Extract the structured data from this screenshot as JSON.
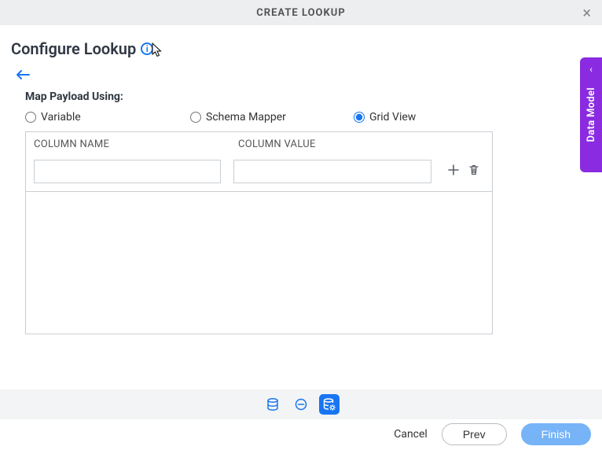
{
  "modal": {
    "title": "CREATE LOOKUP"
  },
  "page": {
    "heading": "Configure Lookup"
  },
  "section": {
    "label": "Map Payload Using:"
  },
  "radios": {
    "variable": "Variable",
    "schema_mapper": "Schema Mapper",
    "grid_view": "Grid View",
    "selected": "grid_view"
  },
  "grid": {
    "col_name_header": "COLUMN NAME",
    "col_value_header": "COLUMN VALUE",
    "rows": [
      {
        "name": "",
        "value": ""
      }
    ]
  },
  "side_panel": {
    "label": "Data Model"
  },
  "footer": {
    "cancel": "Cancel",
    "prev": "Prev",
    "finish": "Finish"
  }
}
